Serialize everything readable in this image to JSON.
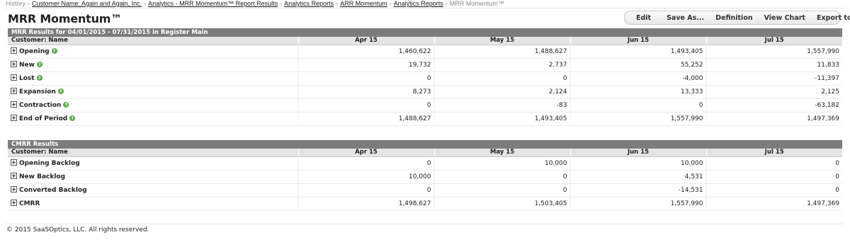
{
  "breadcrumb": {
    "history": "History",
    "items": [
      "Customer Name: Again and Again, Inc.",
      "Analytics - MRR Momentum™ Report Results",
      "Analytics Reports",
      "ARR Momentum",
      "Analytics Reports"
    ],
    "current": "MRR Momentum™",
    "separator": "›"
  },
  "page_title": "MRR Momentum™",
  "toolbar": {
    "edit": "Edit",
    "save_as": "Save As...",
    "definition": "Definition",
    "view_chart": "View Chart",
    "export_csv": "Export to CSV"
  },
  "mrr_section": {
    "title": "MRR Results for 04/01/2015 - 07/31/2015 in Register Main",
    "header_label": "Customer: Name",
    "columns": [
      "Apr 15",
      "May 15",
      "Jun 15",
      "Jul 15"
    ],
    "rows": [
      {
        "label": "Opening",
        "values": [
          "1,460,622",
          "1,488,627",
          "1,493,405",
          "1,557,990"
        ]
      },
      {
        "label": "New",
        "values": [
          "19,732",
          "2,737",
          "55,252",
          "11,833"
        ]
      },
      {
        "label": "Lost",
        "values": [
          "0",
          "0",
          "-4,000",
          "-11,397"
        ]
      },
      {
        "label": "Expansion",
        "values": [
          "8,273",
          "2,124",
          "13,333",
          "2,125"
        ]
      },
      {
        "label": "Contraction",
        "values": [
          "0",
          "-83",
          "0",
          "-63,182"
        ]
      },
      {
        "label": "End of Period",
        "values": [
          "1,488,627",
          "1,493,405",
          "1,557,990",
          "1,497,369"
        ]
      }
    ]
  },
  "cmrr_section": {
    "title": "CMRR Results",
    "header_label": "Customer: Name",
    "columns": [
      "Apr 15",
      "May 15",
      "Jun 15",
      "Jul 15"
    ],
    "rows": [
      {
        "label": "Opening Backlog",
        "values": [
          "0",
          "10,000",
          "10,000",
          "0"
        ]
      },
      {
        "label": "New Backlog",
        "values": [
          "10,000",
          "0",
          "4,531",
          "0"
        ]
      },
      {
        "label": "Converted Backlog",
        "values": [
          "0",
          "0",
          "-14,531",
          "0"
        ]
      },
      {
        "label": "CMRR",
        "values": [
          "1,498,627",
          "1,503,405",
          "1,557,990",
          "1,497,369"
        ]
      }
    ]
  },
  "help_glyph": "?",
  "footer": "© 2015 SaaSOptics, LLC. All rights reserved."
}
